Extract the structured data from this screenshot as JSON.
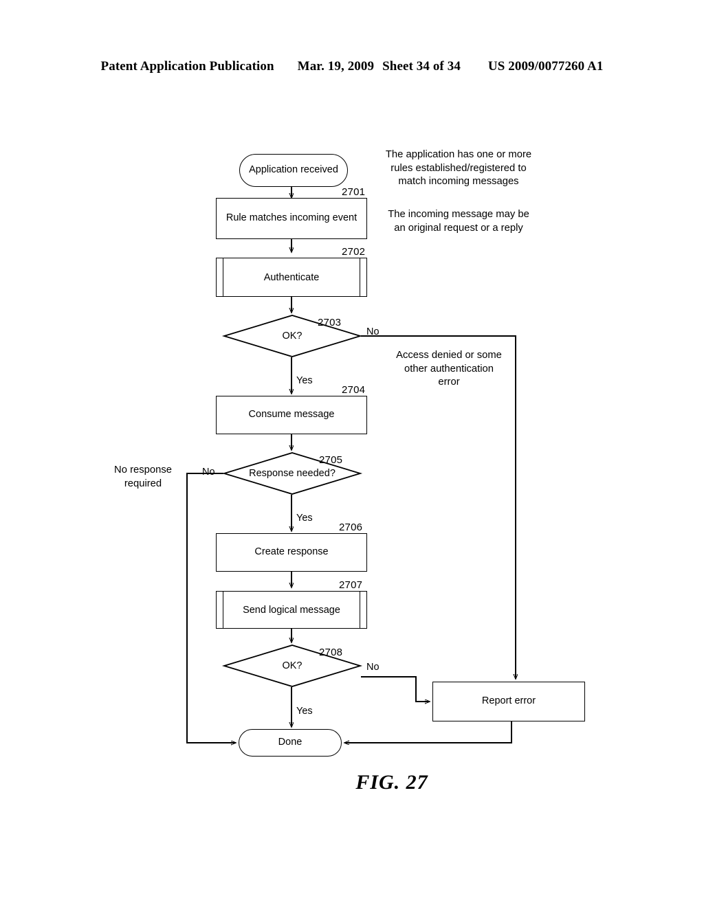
{
  "header": {
    "publication": "Patent Application Publication",
    "date": "Mar. 19, 2009",
    "sheet": "Sheet 34 of 34",
    "patent_number": "US 2009/0077260 A1"
  },
  "figure": {
    "caption": "FIG. 27"
  },
  "chart_data": {
    "type": "diagram",
    "diagram_kind": "flowchart",
    "title": "FIG. 27"
  },
  "flowchart": {
    "nodes": [
      {
        "id": "start",
        "label": "Application received",
        "shape": "stadium",
        "ref": ""
      },
      {
        "id": "n2701",
        "label": "Rule matches incoming event",
        "shape": "process",
        "ref": "2701"
      },
      {
        "id": "n2702",
        "label": "Authenticate",
        "shape": "predefined-process",
        "ref": "2702"
      },
      {
        "id": "n2703",
        "label": "OK?",
        "shape": "decision",
        "ref": "2703"
      },
      {
        "id": "n2704",
        "label": "Consume message",
        "shape": "process",
        "ref": "2704"
      },
      {
        "id": "n2705",
        "label": "Response needed?",
        "shape": "decision",
        "ref": "2705"
      },
      {
        "id": "n2706",
        "label": "Create response",
        "shape": "process",
        "ref": "2706"
      },
      {
        "id": "n2707",
        "label": "Send logical message",
        "shape": "predefined-process",
        "ref": "2707"
      },
      {
        "id": "n2708",
        "label": "OK?",
        "shape": "decision",
        "ref": "2708"
      },
      {
        "id": "reporterr",
        "label": "Report error",
        "shape": "process",
        "ref": ""
      },
      {
        "id": "done",
        "label": "Done",
        "shape": "stadium",
        "ref": ""
      }
    ],
    "branch_labels": {
      "d2703_no": "No",
      "d2703_yes": "Yes",
      "d2705_no": "No",
      "d2705_yes": "Yes",
      "d2708_no": "No",
      "d2708_yes": "Yes"
    },
    "annotations": [
      {
        "id": "a_rules",
        "text": "The application has one or more\nrules established/registered to\nmatch incoming messages"
      },
      {
        "id": "a_incoming",
        "text": "The incoming message may be\nan original request or a reply"
      },
      {
        "id": "a_denied",
        "text": "Access denied or some\nother authentication\nerror"
      },
      {
        "id": "a_noresp",
        "text": "No response\nrequired"
      }
    ]
  }
}
